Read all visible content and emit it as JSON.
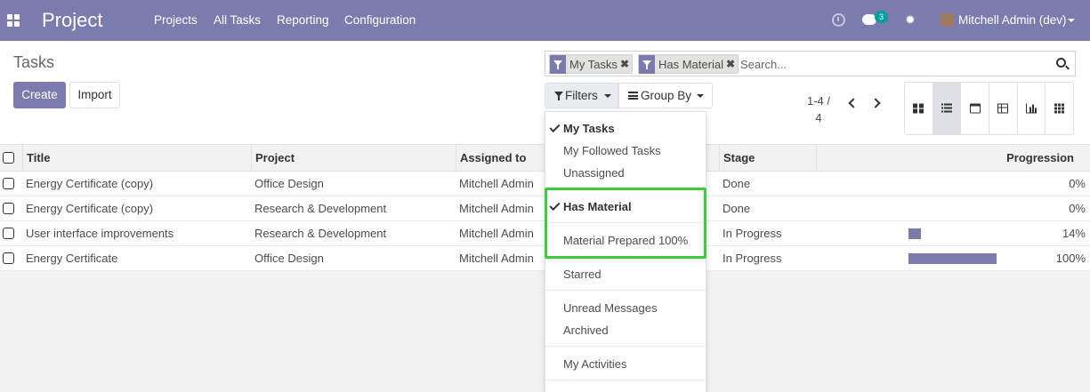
{
  "navbar": {
    "brand": "Project",
    "menu": [
      "Projects",
      "All Tasks",
      "Reporting",
      "Configuration"
    ],
    "chat_badge": "3",
    "user": "Mitchell Admin (dev)",
    "colors": {
      "primary": "#7c7bad",
      "badge": "#00a09d"
    }
  },
  "control_panel": {
    "breadcrumb": "Tasks",
    "create_label": "Create",
    "import_label": "Import",
    "facets": [
      "My Tasks",
      "Has Material"
    ],
    "search_placeholder": "Search...",
    "filters_label": "Filters",
    "groupby_label": "Group By",
    "pager_line1": "1-4 /",
    "pager_line2": "4",
    "views": [
      "kanban-icon",
      "list-icon",
      "calendar-icon",
      "pivot-icon",
      "graph-icon",
      "activity-icon"
    ],
    "active_view": "list-icon"
  },
  "table": {
    "columns": [
      "Title",
      "Project",
      "Assigned to",
      "Stage",
      "Progression"
    ],
    "rows": [
      {
        "title": "Energy Certificate (copy)",
        "project": "Office Design",
        "assigned": "Mitchell Admin",
        "stage": "Done",
        "progress": 0,
        "progress_label": "0%"
      },
      {
        "title": "Energy Certificate (copy)",
        "project": "Research & Development",
        "assigned": "Mitchell Admin",
        "stage": "Done",
        "progress": 0,
        "progress_label": "0%"
      },
      {
        "title": "User interface improvements",
        "project": "Research & Development",
        "assigned": "Mitchell Admin",
        "stage": "In Progress",
        "progress": 14,
        "progress_label": "14%"
      },
      {
        "title": "Energy Certificate",
        "project": "Office Design",
        "assigned": "Mitchell Admin",
        "stage": "In Progress",
        "progress": 100,
        "progress_label": "100%"
      }
    ]
  },
  "filters_dropdown": {
    "items": [
      {
        "label": "My Tasks",
        "selected": true
      },
      {
        "label": "My Followed Tasks",
        "selected": false
      },
      {
        "label": "Unassigned",
        "selected": false
      },
      {
        "label": "Has Material",
        "selected": true
      },
      {
        "label": "Material Prepared 100%",
        "selected": false
      },
      {
        "label": "Starred",
        "selected": false
      },
      {
        "label": "Unread Messages",
        "selected": false
      },
      {
        "label": "Archived",
        "selected": false
      },
      {
        "label": "My Activities",
        "selected": false
      }
    ],
    "highlight_color": "#3ecc3e"
  }
}
